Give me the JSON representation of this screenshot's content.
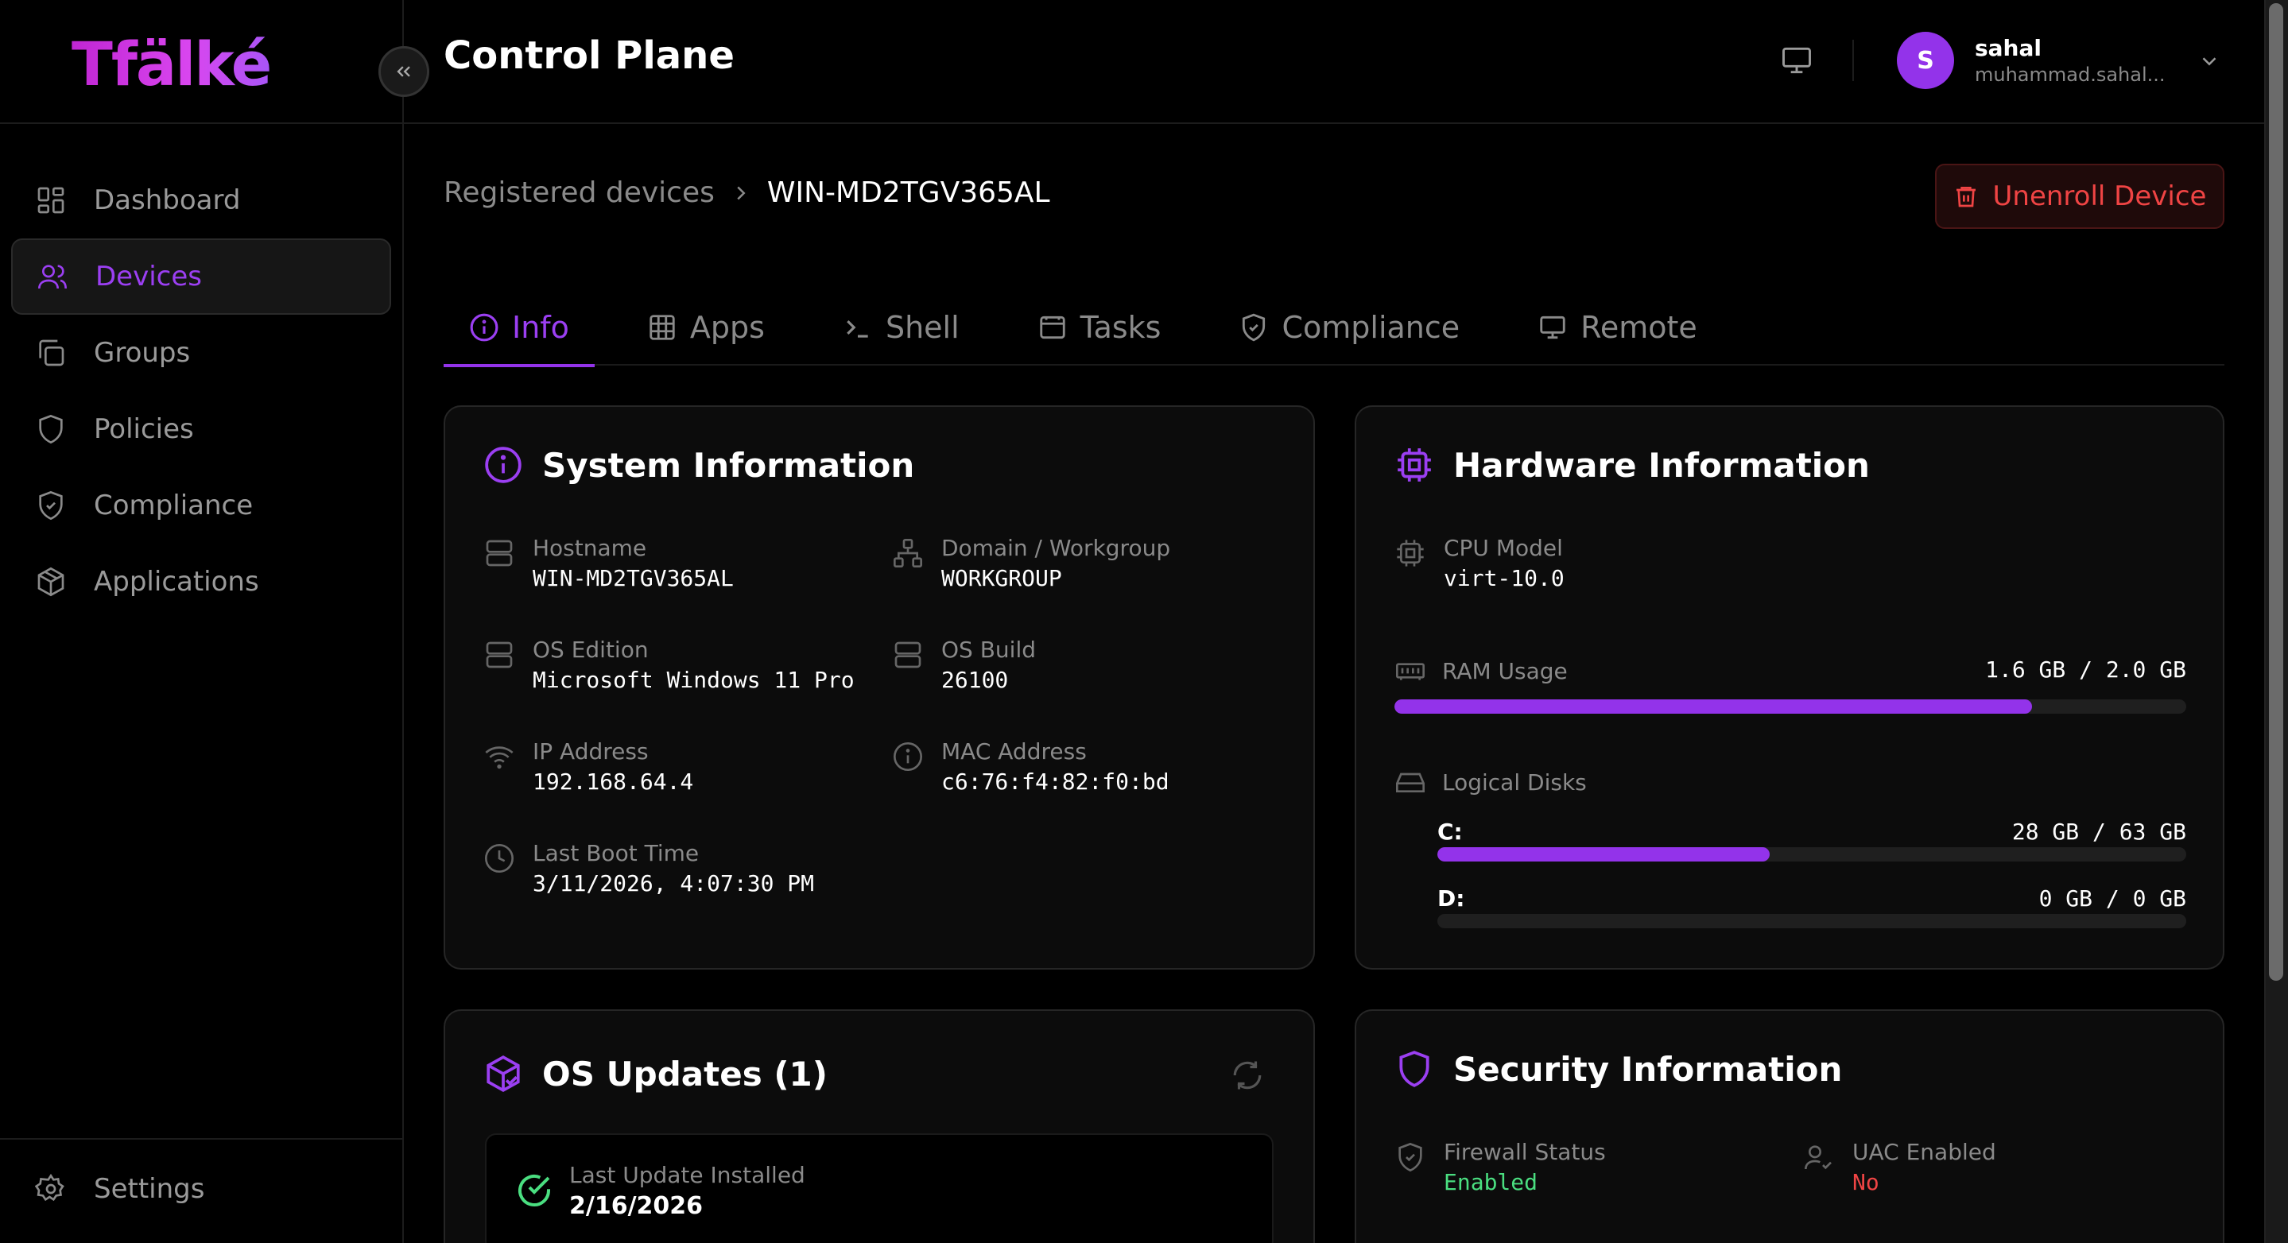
{
  "brand": "Tfälké",
  "header": {
    "title": "Control Plane",
    "user": {
      "initial": "S",
      "name": "sahal",
      "email": "muhammad.sahal..."
    }
  },
  "sidebar": {
    "items": [
      {
        "label": "Dashboard",
        "icon": "grid-icon"
      },
      {
        "label": "Devices",
        "icon": "users-icon",
        "active": true
      },
      {
        "label": "Groups",
        "icon": "copy-icon"
      },
      {
        "label": "Policies",
        "icon": "shield-icon"
      },
      {
        "label": "Compliance",
        "icon": "shield-check-icon"
      },
      {
        "label": "Applications",
        "icon": "package-icon"
      }
    ],
    "settings_label": "Settings"
  },
  "breadcrumb": {
    "parent": "Registered devices",
    "current": "WIN-MD2TGV365AL"
  },
  "actions": {
    "unenroll_label": "Unenroll Device"
  },
  "tabs": [
    {
      "label": "Info",
      "active": true
    },
    {
      "label": "Apps"
    },
    {
      "label": "Shell"
    },
    {
      "label": "Tasks"
    },
    {
      "label": "Compliance"
    },
    {
      "label": "Remote"
    }
  ],
  "system": {
    "title": "System Information",
    "hostname_label": "Hostname",
    "hostname": "WIN-MD2TGV365AL",
    "domain_label": "Domain / Workgroup",
    "domain": "WORKGROUP",
    "os_edition_label": "OS Edition",
    "os_edition": "Microsoft Windows 11 Pro",
    "os_build_label": "OS Build",
    "os_build": "26100",
    "ip_label": "IP Address",
    "ip": "192.168.64.4",
    "mac_label": "MAC Address",
    "mac": "c6:76:f4:82:f0:bd",
    "boot_label": "Last Boot Time",
    "boot": "3/11/2026, 4:07:30 PM"
  },
  "hardware": {
    "title": "Hardware Information",
    "cpu_label": "CPU Model",
    "cpu": "virt-10.0",
    "ram_label": "RAM Usage",
    "ram_text": "1.6 GB / 2.0 GB",
    "ram_fraction": 0.805,
    "disks_label": "Logical Disks",
    "disks": [
      {
        "letter": "C:",
        "text": "28 GB / 63 GB",
        "fraction": 0.444
      },
      {
        "letter": "D:",
        "text": "0 GB / 0 GB",
        "fraction": 0
      }
    ]
  },
  "updates": {
    "title": "OS Updates (1)",
    "last_label": "Last Update Installed",
    "last_value": "2/16/2026"
  },
  "security": {
    "title": "Security Information",
    "firewall_label": "Firewall Status",
    "firewall": "Enabled",
    "uac_label": "UAC Enabled",
    "uac": "No",
    "colors": {
      "enabled": "#4ade80",
      "disabled": "#ef4444"
    }
  },
  "colors": {
    "accent": "#9333ea",
    "danger": "#ef4444"
  }
}
